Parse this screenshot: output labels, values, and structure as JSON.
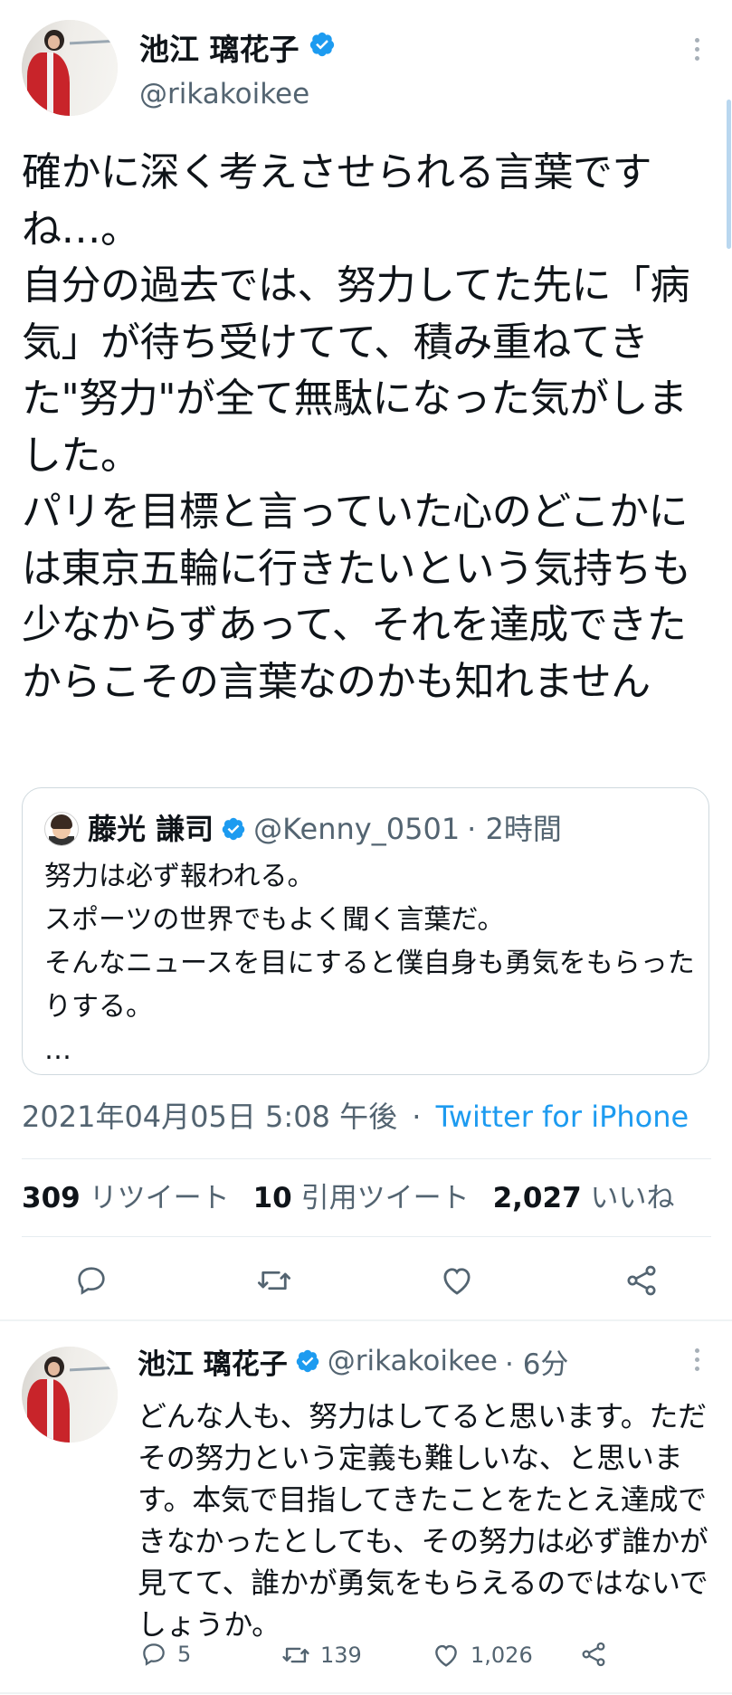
{
  "tweet": {
    "display_name": "池江 璃花子",
    "handle": "@rikakoikee",
    "text_lines": [
      "確かに深く考えさせられる言葉ですね…。",
      "自分の過去では、努力してた先に「病気」が待ち受けてて、積み重ねてきた\"努力\"が全て無駄になった気がしました。",
      "パリを目標と言っていた心のどこかには東京五輪に行きたいという気持ちも少なからずあって、それを達成できたからこその言葉なのかも知れません"
    ],
    "quoted": {
      "display_name": "藤光 謙司",
      "handle": "@Kenny_0501",
      "time": "· 2時間",
      "text_lines": [
        "努力は必ず報われる。",
        "スポーツの世界でもよく聞く言葉だ。",
        "そんなニュースを目にすると僕自身も勇気をもらったりする。",
        "…"
      ]
    },
    "timestamp": "2021年04月05日 5:08 午後",
    "separator": "·",
    "source": "Twitter for iPhone",
    "stats": {
      "retweets_count": "309",
      "retweets_label": "リツイート",
      "quotes_count": "10",
      "quotes_label": "引用ツイート",
      "likes_count": "2,027",
      "likes_label": "いいね"
    }
  },
  "reply": {
    "display_name": "池江 璃花子",
    "handle": "@rikakoikee",
    "time": "· 6分",
    "text": "どんな人も、努力はしてると思います。ただその努力という定義も難しいな、と思います。本気で目指してきたことをたとえ達成できなかったとしても、その努力は必ず誰かが見てて、誰かが勇気をもらえるのではないでしょうか。",
    "reply_count": "5",
    "retweet_count": "139",
    "like_count": "1,026"
  },
  "colors": {
    "verified": "#1d9bf0",
    "link": "#1d9bf0",
    "muted": "#536471",
    "icon": "#536471"
  }
}
